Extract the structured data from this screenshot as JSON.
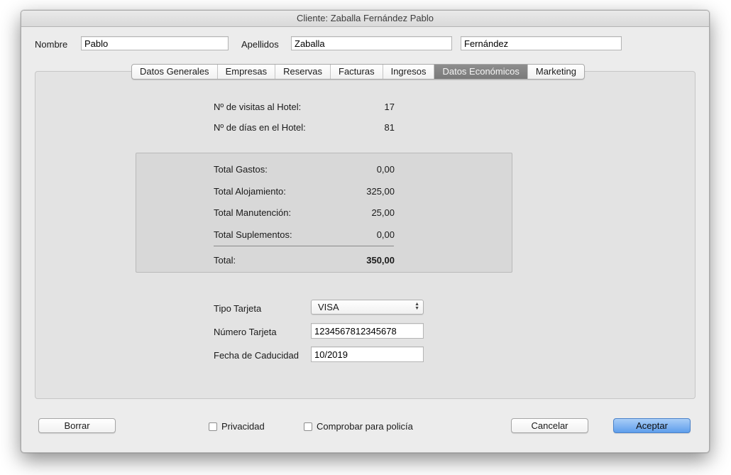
{
  "window": {
    "title": "Cliente: Zaballa Fernández Pablo"
  },
  "header": {
    "nombre_label": "Nombre",
    "nombre_value": "Pablo",
    "apellidos_label": "Apellidos",
    "apellido1_value": "Zaballa",
    "apellido2_value": "Fernández"
  },
  "tabs": [
    {
      "label": "Datos Generales",
      "active": false
    },
    {
      "label": "Empresas",
      "active": false
    },
    {
      "label": "Reservas",
      "active": false
    },
    {
      "label": "Facturas",
      "active": false
    },
    {
      "label": "Ingresos",
      "active": false
    },
    {
      "label": "Datos Económicos",
      "active": true
    },
    {
      "label": "Marketing",
      "active": false
    }
  ],
  "stats": {
    "visitas_label": "Nº de visitas al Hotel:",
    "visitas_value": "17",
    "dias_label": "Nº de días en el Hotel:",
    "dias_value": "81"
  },
  "totals": {
    "gastos_label": "Total Gastos:",
    "gastos_value": "0,00",
    "alojamiento_label": "Total Alojamiento:",
    "alojamiento_value": "325,00",
    "manutencion_label": "Total Manutención:",
    "manutencion_value": "25,00",
    "suplementos_label": "Total Suplementos:",
    "suplementos_value": "0,00",
    "total_label": "Total:",
    "total_value": "350,00"
  },
  "card": {
    "tipo_label": "Tipo Tarjeta",
    "tipo_value": "VISA",
    "numero_label": "Número Tarjeta",
    "numero_value": "1234567812345678",
    "caducidad_label": "Fecha de Caducidad",
    "caducidad_value": "10/2019"
  },
  "footer": {
    "borrar_label": "Borrar",
    "privacidad_label": "Privacidad",
    "privacidad_checked": false,
    "policia_label": "Comprobar para policía",
    "policia_checked": false,
    "cancelar_label": "Cancelar",
    "aceptar_label": "Aceptar"
  },
  "colors": {
    "active_tab": "#7f7f7f",
    "default_button": "#5e9eec",
    "panel": "#e3e3e3"
  }
}
